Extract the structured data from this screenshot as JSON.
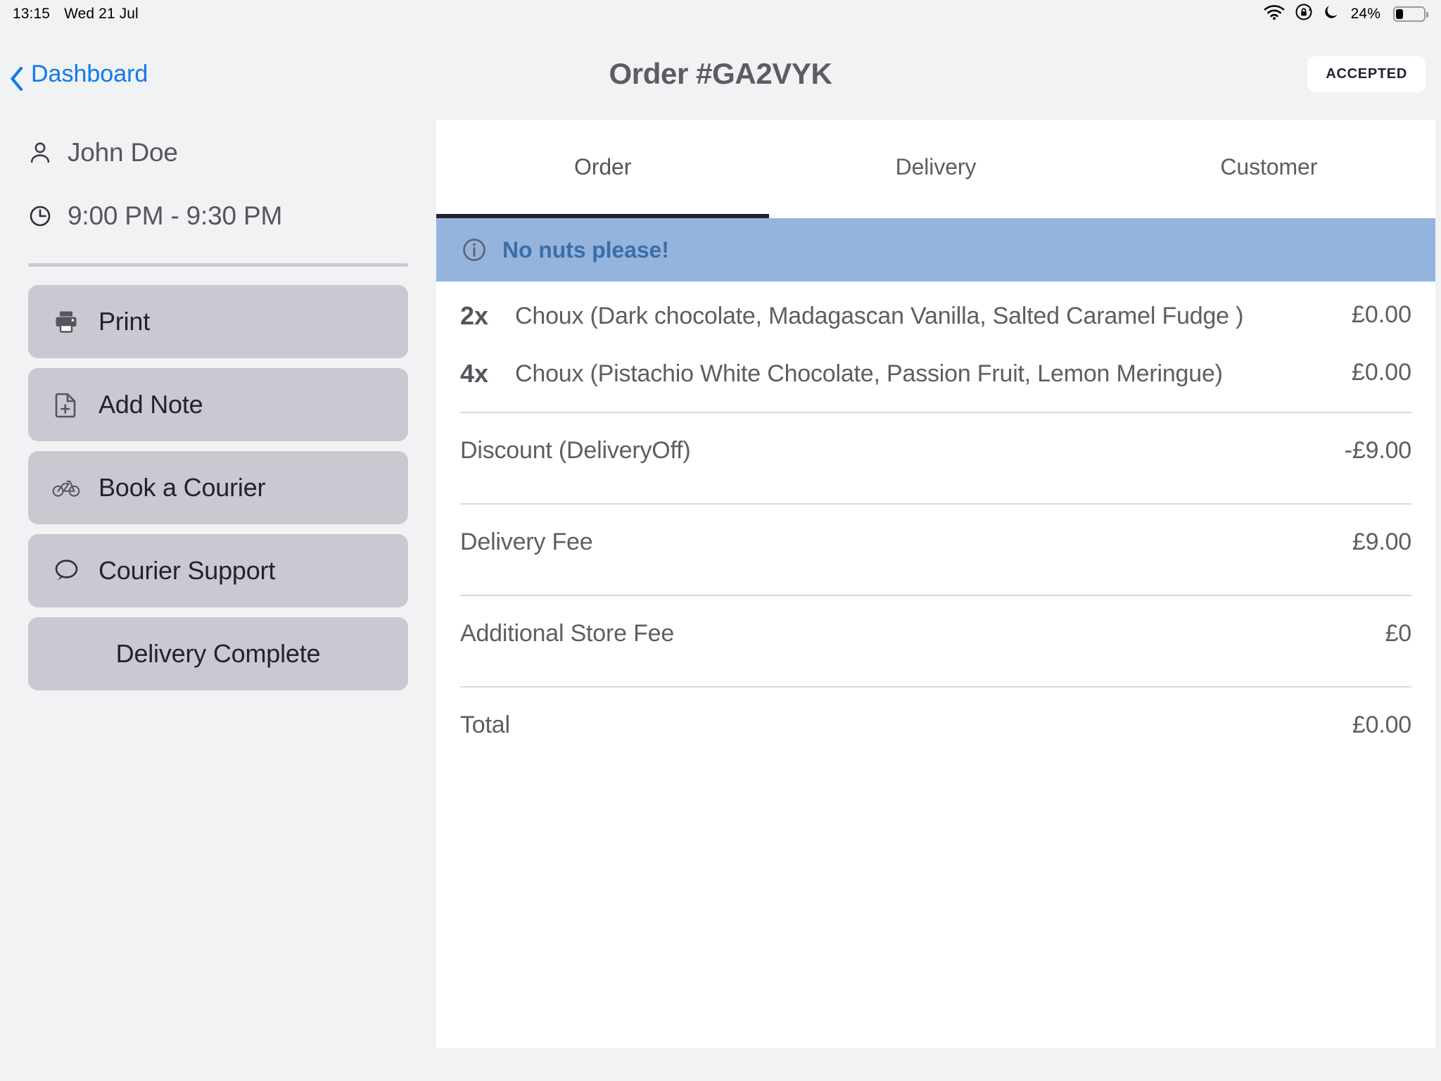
{
  "statusbar": {
    "time": "13:15",
    "date": "Wed 21 Jul",
    "battery_pct": "24%",
    "icons": [
      "wifi-icon",
      "rotation-lock-icon",
      "do-not-disturb-moon-icon",
      "battery-icon"
    ]
  },
  "header": {
    "back_label": "Dashboard",
    "title": "Order #GA2VYK",
    "status_badge": "ACCEPTED"
  },
  "sidebar": {
    "customer_name": "John Doe",
    "time_window": "9:00 PM - 9:30 PM",
    "buttons": [
      {
        "label": "Print",
        "icon": "printer-icon"
      },
      {
        "label": "Add Note",
        "icon": "note-add-icon"
      },
      {
        "label": "Book a Courier",
        "icon": "bicycle-icon"
      },
      {
        "label": "Courier Support",
        "icon": "chat-bubble-icon"
      },
      {
        "label": "Delivery Complete",
        "icon": ""
      }
    ]
  },
  "panel": {
    "tabs": [
      {
        "label": "Order",
        "active": true
      },
      {
        "label": "Delivery",
        "active": false
      },
      {
        "label": "Customer",
        "active": false
      }
    ],
    "note": {
      "icon": "info-circle-icon",
      "text": "No nuts please!"
    },
    "items": [
      {
        "qty": "2x",
        "name": "Choux (Dark chocolate, Madagascan Vanilla, Salted Caramel Fudge )",
        "price": "£0.00"
      },
      {
        "qty": "4x",
        "name": "Choux (Pistachio White Chocolate, Passion Fruit, Lemon Meringue)",
        "price": "£0.00"
      }
    ],
    "fees": [
      {
        "label": "Discount (DeliveryOff)",
        "value": "-£9.00"
      },
      {
        "label": "Delivery Fee",
        "value": "£9.00"
      },
      {
        "label": "Additional Store Fee",
        "value": "£0"
      },
      {
        "label": "Total",
        "value": "£0.00"
      }
    ]
  },
  "colors": {
    "page_bg": "#f1f2f4",
    "accent_blue": "#1279ea",
    "button_grey": "#c8c9d1",
    "note_bg": "#94b4dd",
    "note_text": "#3b6ea8",
    "text_grey": "#5d5e63",
    "dark": "#23232f"
  }
}
